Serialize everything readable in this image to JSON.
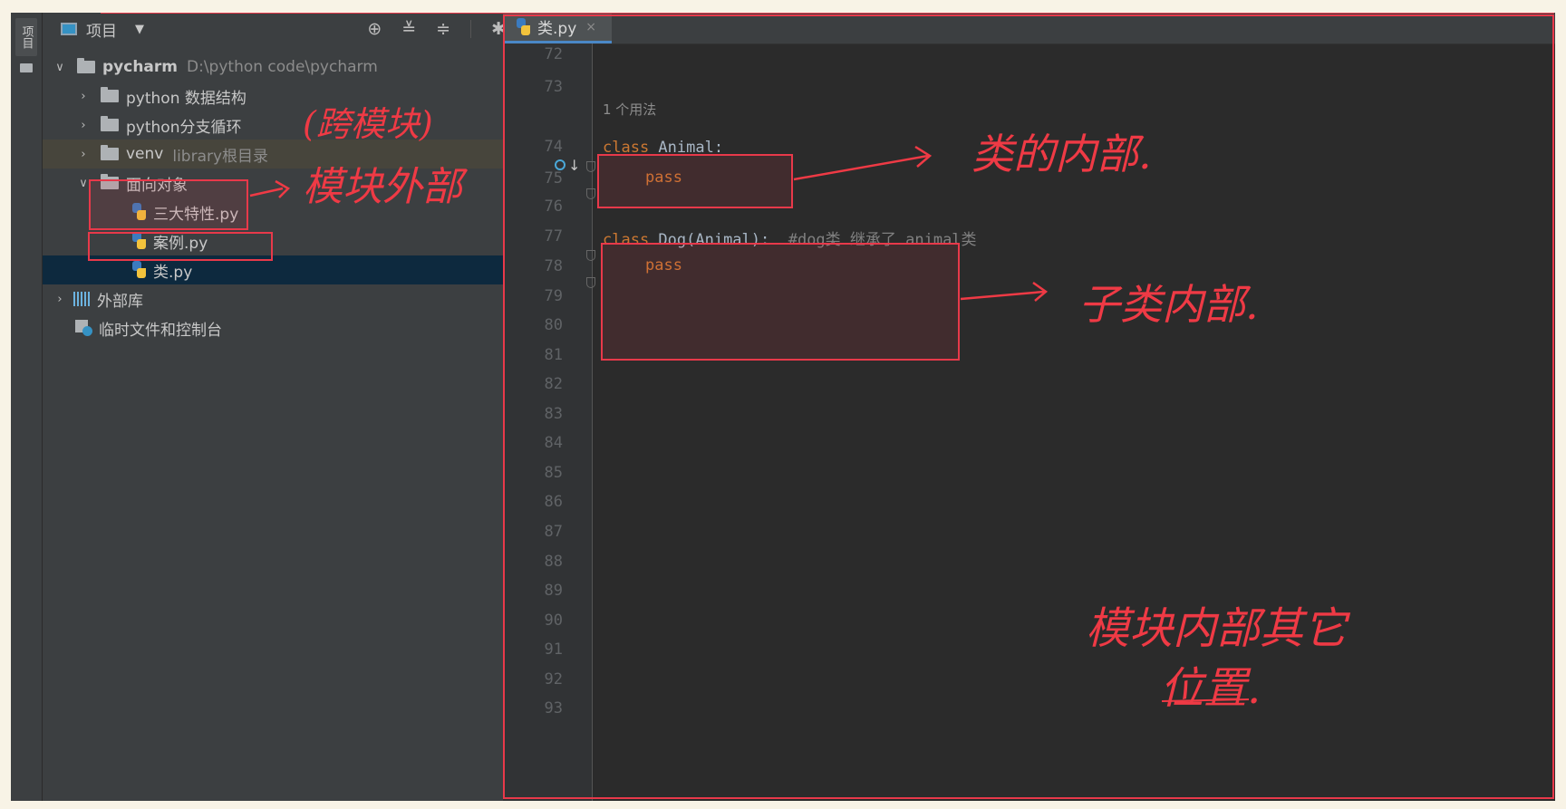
{
  "sidebar_stripe": {
    "tab_label": "项目"
  },
  "project_panel": {
    "title": "项目",
    "tree": {
      "root": {
        "name": "pycharm",
        "path": "D:\\python code\\pycharm"
      },
      "folders": [
        {
          "name": "python 数据结构"
        },
        {
          "name": "python分支循环"
        },
        {
          "name": "venv",
          "hint": "library根目录"
        },
        {
          "name": "面向对象"
        }
      ],
      "files": [
        {
          "name": "三大特性.py"
        },
        {
          "name": "案例.py"
        },
        {
          "name": "类.py"
        }
      ],
      "external_libs": "外部库",
      "scratches": "临时文件和控制台"
    }
  },
  "editor": {
    "tab": {
      "label": "类.py",
      "close": "×"
    },
    "usage_hint": "1 个用法",
    "line_numbers": [
      "72",
      "73",
      "74",
      "75",
      "76",
      "77",
      "78",
      "79",
      "80",
      "81",
      "82",
      "83",
      "84",
      "85",
      "86",
      "87",
      "88",
      "89",
      "90",
      "91",
      "92",
      "93"
    ],
    "code": {
      "l74_kw": "class",
      "l74_rest": " Animal:",
      "l75_kw": "pass",
      "l77_kw": "class",
      "l77_rest": " Dog(Animal):  ",
      "l77_comment": "#dog类 继承了 animal类",
      "l78_kw": "pass"
    }
  },
  "annotations": {
    "cross_module": "(跨模块)",
    "module_outside": "模块外部",
    "class_inside": "类的内部.",
    "subclass_inside": "子类内部.",
    "module_other_line1": "模块内部其它",
    "module_other_line2": "位置."
  },
  "colors": {
    "annotation_red": "#e8394a",
    "keyword": "#cc7832",
    "comment": "#808080"
  }
}
